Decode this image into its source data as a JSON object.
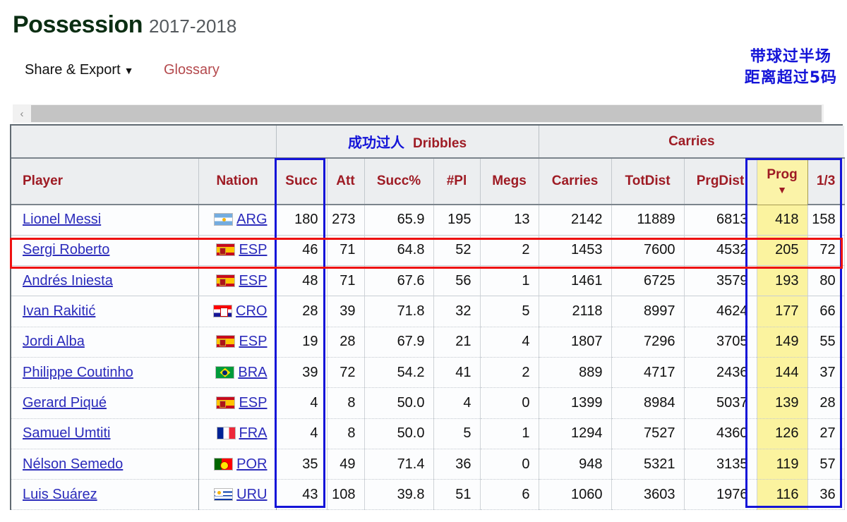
{
  "header": {
    "title": "Possession",
    "season": "2017-2018"
  },
  "toolbar": {
    "share_export": "Share & Export",
    "caret": "▼",
    "glossary": "Glossary"
  },
  "annotations": {
    "top_right_cn_line1": "带球过半场",
    "top_right_cn_line2": "距离超过5码",
    "dribbles_cn": "成功过人",
    "colors": {
      "blue_box": "#1414d8",
      "red_box": "#ee1111",
      "highlight_yellow": "#fbf39f",
      "header_red": "#9e1b24",
      "link_blue": "#2b2bbb"
    }
  },
  "scrollbar": {
    "left_arrow": "‹"
  },
  "table": {
    "group_headers": {
      "blank": "",
      "dribbles": "Dribbles",
      "carries": "Carries"
    },
    "columns": [
      "Player",
      "Nation",
      "Succ",
      "Att",
      "Succ%",
      "#Pl",
      "Megs",
      "Carries",
      "TotDist",
      "PrgDist",
      "Prog",
      "1/3"
    ],
    "sorted_column": "Prog",
    "sort_direction": "▼",
    "rows": [
      {
        "player": "Lionel Messi",
        "nation": "ARG",
        "flag": "f-arg",
        "succ": "180",
        "att": "273",
        "succ_pct": "65.9",
        "pl": "195",
        "megs": "13",
        "carries": "2142",
        "totdist": "11889",
        "prgdist": "6813",
        "prog": "418",
        "third": "158"
      },
      {
        "player": "Sergi Roberto",
        "nation": "ESP",
        "flag": "f-esp",
        "succ": "46",
        "att": "71",
        "succ_pct": "64.8",
        "pl": "52",
        "megs": "2",
        "carries": "1453",
        "totdist": "7600",
        "prgdist": "4532",
        "prog": "205",
        "third": "72"
      },
      {
        "player": "Andrés Iniesta",
        "nation": "ESP",
        "flag": "f-esp",
        "succ": "48",
        "att": "71",
        "succ_pct": "67.6",
        "pl": "56",
        "megs": "1",
        "carries": "1461",
        "totdist": "6725",
        "prgdist": "3579",
        "prog": "193",
        "third": "80"
      },
      {
        "player": "Ivan Rakitić",
        "nation": "CRO",
        "flag": "f-cro",
        "succ": "28",
        "att": "39",
        "succ_pct": "71.8",
        "pl": "32",
        "megs": "5",
        "carries": "2118",
        "totdist": "8997",
        "prgdist": "4624",
        "prog": "177",
        "third": "66"
      },
      {
        "player": "Jordi Alba",
        "nation": "ESP",
        "flag": "f-esp",
        "succ": "19",
        "att": "28",
        "succ_pct": "67.9",
        "pl": "21",
        "megs": "4",
        "carries": "1807",
        "totdist": "7296",
        "prgdist": "3705",
        "prog": "149",
        "third": "55"
      },
      {
        "player": "Philippe Coutinho",
        "nation": "BRA",
        "flag": "f-bra",
        "succ": "39",
        "att": "72",
        "succ_pct": "54.2",
        "pl": "41",
        "megs": "2",
        "carries": "889",
        "totdist": "4717",
        "prgdist": "2436",
        "prog": "144",
        "third": "37"
      },
      {
        "player": "Gerard Piqué",
        "nation": "ESP",
        "flag": "f-esp",
        "succ": "4",
        "att": "8",
        "succ_pct": "50.0",
        "pl": "4",
        "megs": "0",
        "carries": "1399",
        "totdist": "8984",
        "prgdist": "5037",
        "prog": "139",
        "third": "28"
      },
      {
        "player": "Samuel Umtiti",
        "nation": "FRA",
        "flag": "f-fra",
        "succ": "4",
        "att": "8",
        "succ_pct": "50.0",
        "pl": "5",
        "megs": "1",
        "carries": "1294",
        "totdist": "7527",
        "prgdist": "4360",
        "prog": "126",
        "third": "27"
      },
      {
        "player": "Nélson Semedo",
        "nation": "POR",
        "flag": "f-por",
        "succ": "35",
        "att": "49",
        "succ_pct": "71.4",
        "pl": "36",
        "megs": "0",
        "carries": "948",
        "totdist": "5321",
        "prgdist": "3135",
        "prog": "119",
        "third": "57"
      },
      {
        "player": "Luis Suárez",
        "nation": "URU",
        "flag": "f-uru",
        "succ": "43",
        "att": "108",
        "succ_pct": "39.8",
        "pl": "51",
        "megs": "6",
        "carries": "1060",
        "totdist": "3603",
        "prgdist": "1976",
        "prog": "116",
        "third": "36"
      }
    ]
  }
}
